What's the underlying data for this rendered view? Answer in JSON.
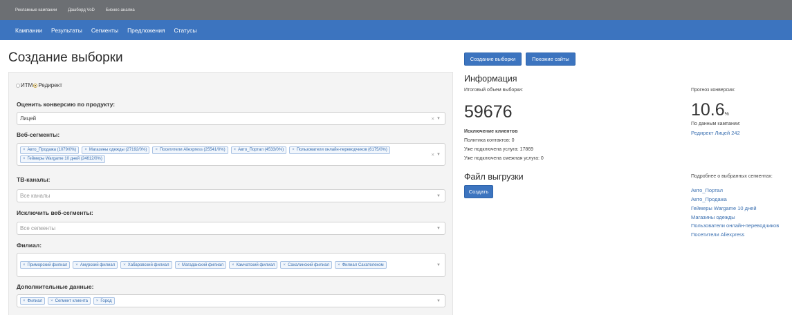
{
  "topbar": {
    "items": [
      "Рекламные кампании",
      "Дашборд VoD",
      "Бизнес-аналиа"
    ]
  },
  "nav": {
    "items": [
      "Кампании",
      "Результаты",
      "Сегменты",
      "Предложения",
      "Статусы"
    ]
  },
  "page": {
    "title": "Создание выборки"
  },
  "actions": {
    "create_sample": "Создание выборки",
    "similar_sites": "Похожие сайты"
  },
  "form": {
    "radio_itm": "ИТМ",
    "radio_redirect": "Редирект",
    "product": {
      "label": "Оценить конверсию по продукту:",
      "value": "Лицей"
    },
    "web_segments": {
      "label": "Веб-сегменты:",
      "tags": [
        "Авто_Продажа (1079/0%)",
        "Магазины одежды (27192/0%)",
        "Посетители Aliexpress (25541/0%)",
        "Авто_Портал (4533/0%)",
        "Пользователи онлайн-переводчиков (6175/0%)",
        "Геймеры Wargame 10 дней (24612/0%)"
      ]
    },
    "tv_channels": {
      "label": "ТВ-каналы:",
      "placeholder": "Все каналы"
    },
    "exclude_segments": {
      "label": "Исключить веб-сегменты:",
      "placeholder": "Все сегменты"
    },
    "branch": {
      "label": "Филиал:",
      "tags": [
        "Приморский филиал",
        "Амурский филиал",
        "Хабаровский филиал",
        "Магаданский филиал",
        "Камчатский филиал",
        "Сахалинский филиал",
        "Филиал Сахателеком"
      ]
    },
    "extra": {
      "label": "Дополнительные данные:",
      "tags": [
        "Филиал",
        "Сегмент клиента",
        "Город"
      ]
    }
  },
  "info": {
    "title": "Информация",
    "total_label": "Итоговый объем выборки:",
    "total_value": "59676",
    "forecast_label": "Прогноз конверсии:",
    "forecast_value": "10.6",
    "forecast_unit": "%",
    "campaign_label": "По данным кампании:",
    "campaign_link": "Редирект Лицей 242",
    "exclusion_title": "Исключение клиентов",
    "policy": "Политика контактов: 0",
    "connected": "Уже подключена услуга: 17869",
    "related": "Уже подключена смежная услуга: 0"
  },
  "export": {
    "title": "Файл выгрузки",
    "create_button": "Создать"
  },
  "segments_info": {
    "label": "Подробнее о выбранных сегментах:",
    "links": [
      "Авто_Портал",
      "Авто_Продажа",
      "Геймеры Wargame 10 дней",
      "Магазины одежды",
      "Пользователи онлайн-переводчиков",
      "Посетители Aliexpress"
    ]
  },
  "colors": {
    "nav": "#3c74bf",
    "topbar": "#6c6f73",
    "link": "#3a6fb0"
  }
}
